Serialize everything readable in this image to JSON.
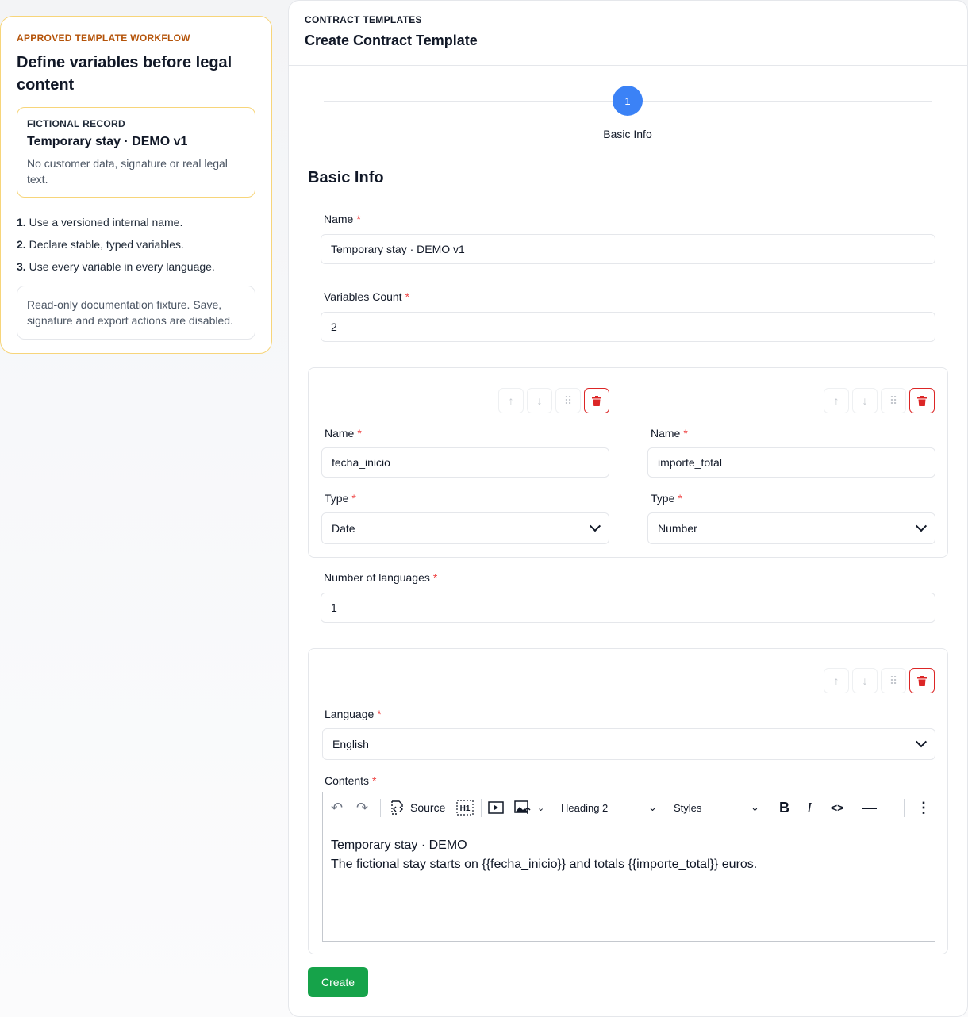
{
  "sidebar": {
    "kicker": "APPROVED TEMPLATE WORKFLOW",
    "title": "Define variables before legal content",
    "record": {
      "kicker": "FICTIONAL RECORD",
      "title": "Temporary stay · DEMO v1",
      "description": "No customer data, signature or real legal text."
    },
    "steps": [
      {
        "num": "1.",
        "text": "Use a versioned internal name."
      },
      {
        "num": "2.",
        "text": "Declare stable, typed variables."
      },
      {
        "num": "3.",
        "text": "Use every variable in every language."
      }
    ],
    "note": "Read-only documentation fixture. Save, signature and export actions are disabled."
  },
  "header": {
    "breadcrumb": "CONTRACT TEMPLATES",
    "title": "Create Contract Template"
  },
  "stepper": {
    "number": "1",
    "label": "Basic Info"
  },
  "section_title": "Basic Info",
  "form": {
    "name_label": "Name",
    "name_value": "Temporary stay · DEMO v1",
    "variables_count_label": "Variables Count",
    "variables_count_value": "2",
    "variables": [
      {
        "name_label": "Name",
        "name_value": "fecha_inicio",
        "type_label": "Type",
        "type_value": "Date"
      },
      {
        "name_label": "Name",
        "name_value": "importe_total",
        "type_label": "Type",
        "type_value": "Number"
      }
    ],
    "languages_count_label": "Number of languages",
    "languages_count_value": "1",
    "language_label": "Language",
    "language_value": "English",
    "contents_label": "Contents",
    "required_mark": "*"
  },
  "editor": {
    "source_label": "Source",
    "heading_value": "Heading 2",
    "styles_value": "Styles",
    "content_line1": "Temporary stay · DEMO",
    "content_line2": "The fictional stay starts on {{fecha_inicio}} and totals {{importe_total}} euros."
  },
  "create_label": "Create",
  "icons": [
    "arrow-up-icon",
    "arrow-down-icon",
    "drag-handle-icon",
    "trash-icon",
    "undo-icon",
    "redo-icon",
    "source-icon",
    "h1-icon",
    "media-icon",
    "image-icon",
    "bold-icon",
    "italic-icon",
    "code-icon",
    "horizontal-line-icon",
    "more-icon",
    "chevron-down-icon"
  ],
  "colors": {
    "accent": "#3b82f6",
    "create": "#16a34a",
    "danger": "#dc2626",
    "sidebar_border": "#f7d57a",
    "kicker": "#b45309"
  }
}
